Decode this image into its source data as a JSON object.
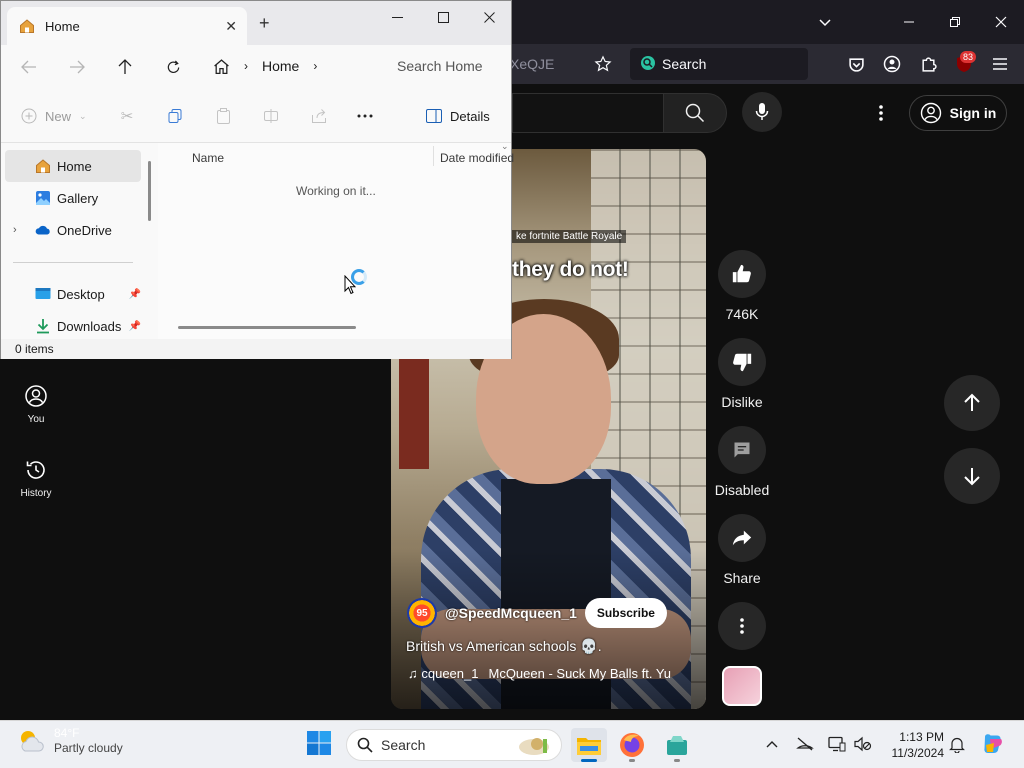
{
  "browser": {
    "url_fragment": "XeQJE",
    "search_placeholder": "Search",
    "extension_badge": "83"
  },
  "youtube": {
    "sign_in": "Sign in",
    "sidebar": [
      {
        "label": "You",
        "icon": "account-circle-icon"
      },
      {
        "label": "History",
        "icon": "history-icon"
      }
    ],
    "video": {
      "caption_small": "ke fortnite Battle Royale",
      "caption_big": "they do not!",
      "channel_avatar_text": "95",
      "channel": "@SpeedMcqueen_1",
      "subscribe": "Subscribe",
      "title": "British vs American schools 💀.",
      "music_channel": "♫ cqueen_1",
      "music_track": "McQueen - Suck My Balls ft. Yu"
    },
    "actions": {
      "like_count": "746K",
      "dislike": "Dislike",
      "comments": "Disabled",
      "share": "Share"
    }
  },
  "explorer": {
    "tab_title": "Home",
    "breadcrumb": "Home",
    "search_placeholder": "Search Home",
    "cmd_new": "New",
    "cmd_details": "Details",
    "nav": [
      {
        "label": "Home"
      },
      {
        "label": "Gallery"
      },
      {
        "label": "OneDrive"
      },
      {
        "label": "Desktop"
      },
      {
        "label": "Downloads"
      }
    ],
    "columns": {
      "name": "Name",
      "date_modified": "Date modified"
    },
    "loading_text": "Working on it...",
    "status": "0 items"
  },
  "taskbar": {
    "weather_temp": "84°F",
    "weather_desc": "Partly cloudy",
    "search_placeholder": "Search",
    "time": "1:13 PM",
    "date": "11/3/2024"
  }
}
